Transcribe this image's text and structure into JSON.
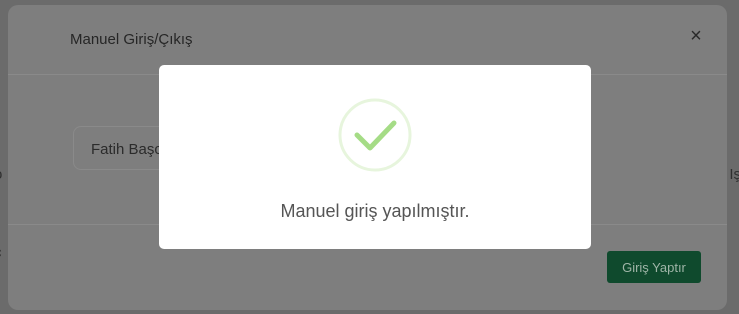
{
  "background_page": {
    "edge_left_text": "o",
    "edge_right_text": "Iş",
    "edge_left_lower_text": "ç"
  },
  "modal": {
    "title": "Manuel Giriş/Çıkış",
    "close_glyph": "×",
    "person_field_value": "Fatih Başc",
    "submit_label": "Giriş Yaptır"
  },
  "dialog": {
    "icon": "success-check-icon",
    "message": "Manuel giriş yapılmıştır."
  },
  "colors": {
    "success_green": "#a5dc86",
    "button_green": "#0f4a2d",
    "overlay_gray": "#6b6b6b"
  }
}
